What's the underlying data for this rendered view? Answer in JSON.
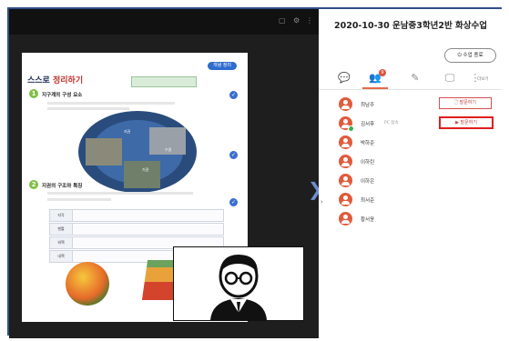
{
  "panel": {
    "title": "2020-10-30 운남중3학년2반 화상수업",
    "end_class_label": "수업 종료",
    "users_badge": "9",
    "more_label": "더보기",
    "question_all_label": "발문하기",
    "question_one_label": "발문하기",
    "students": [
      {
        "name": "최남주",
        "status": ""
      },
      {
        "name": "김서후",
        "status": "PC 접속"
      },
      {
        "name": "박하준",
        "status": ""
      },
      {
        "name": "이하린",
        "status": ""
      },
      {
        "name": "이하은",
        "status": ""
      },
      {
        "name": "최서준",
        "status": ""
      },
      {
        "name": "황서윤",
        "status": ""
      }
    ]
  },
  "textbook": {
    "title_a": "스스로",
    "title_b": "정리하기",
    "review_pill": "개념 정리",
    "section1_num": "1",
    "section1_title": "지구계의 구성 요소",
    "section2_num": "2",
    "section2_title": "지권의 구조와 특징",
    "globe_labels": [
      "지권",
      "수권",
      "기권"
    ],
    "rows": [
      "지각",
      "맨틀",
      "외핵",
      "내핵"
    ]
  },
  "colors": {
    "accent": "#e05b3c",
    "highlight": "#e01e1e",
    "nav_arrow": "#6d8ed1"
  },
  "icons": [
    "chat-icon",
    "users-icon",
    "document-icon",
    "screen-share-icon",
    "more-icon",
    "power-icon",
    "expand-icon",
    "next-page-icon"
  ]
}
